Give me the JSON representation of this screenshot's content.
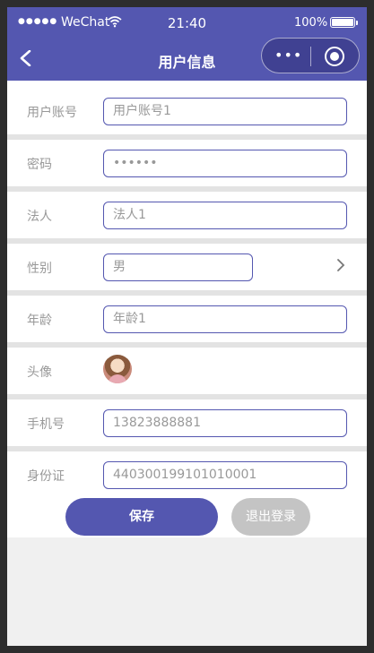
{
  "status_bar": {
    "signal": "●●●●●",
    "carrier": "WeChat",
    "time": "21:40",
    "battery": "100%"
  },
  "nav": {
    "title": "用户信息",
    "capsule_dots": "•••"
  },
  "form": {
    "rows": [
      {
        "label": "用户账号",
        "value": "用户账号1"
      },
      {
        "label": "密码",
        "value": "••••••"
      },
      {
        "label": "法人",
        "value": "法人1"
      },
      {
        "label": "性别",
        "value": "男"
      },
      {
        "label": "年龄",
        "value": "年龄1"
      },
      {
        "label": "头像",
        "value": ""
      },
      {
        "label": "手机号",
        "value": "13823888881"
      },
      {
        "label": "身份证",
        "value": "440300199101010001"
      }
    ]
  },
  "actions": {
    "save": "保存",
    "logout": "退出登录"
  },
  "colors": {
    "primary": "#5457b0",
    "disabled": "#c4c4c4"
  },
  "icons": [
    "back-icon",
    "more-icon",
    "close-mini-program-icon",
    "chevron-right-icon",
    "wifi-icon",
    "battery-icon"
  ]
}
